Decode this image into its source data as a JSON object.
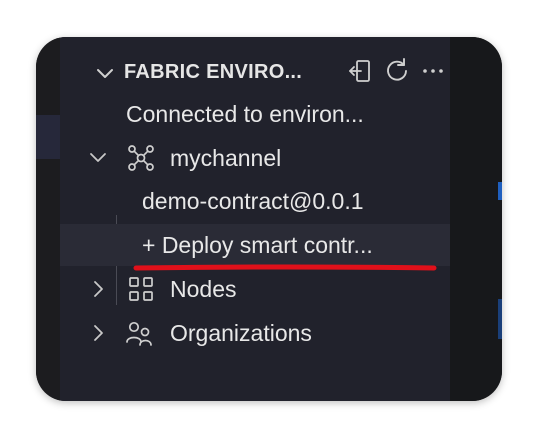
{
  "header": {
    "title": "FABRIC ENVIRO...",
    "icons": [
      "chevron-down-icon",
      "exit-icon",
      "refresh-icon",
      "more-icon"
    ]
  },
  "tree": {
    "connected_label": "Connected to environ...",
    "channel_label": "mychannel",
    "contract_label": "demo-contract@0.0.1",
    "deploy_label": "+ Deploy smart contr...",
    "nodes_label": "Nodes",
    "organizations_label": "Organizations"
  },
  "colors": {
    "panel_bg": "#21222c",
    "text": "#e8e8e8",
    "annotation": "#e0101a"
  }
}
